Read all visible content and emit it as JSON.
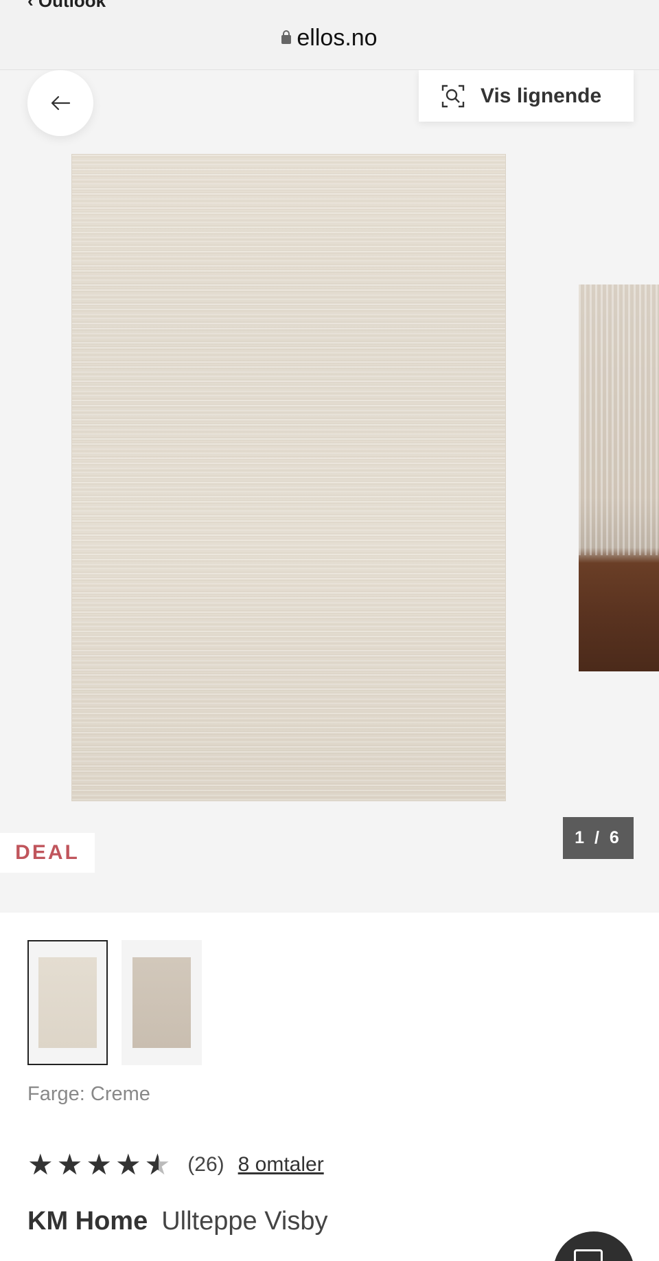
{
  "browser": {
    "back_app_label": "‹ Outlook",
    "url": "ellos.no"
  },
  "gallery": {
    "back_icon": "arrow-left-icon",
    "similar_label": "Vis lignende",
    "similar_icon": "visual-search-icon",
    "deal_label": "DEAL",
    "counter": "1 / 6",
    "deal_color": "#c0555c"
  },
  "thumbnails": [
    {
      "selected": true
    },
    {
      "selected": false
    }
  ],
  "product": {
    "color_line": "Farge: Creme",
    "rating_value": 4.5,
    "rating_count": "(26)",
    "reviews_link": "8 omtaler",
    "brand": "KM Home",
    "name": "Ullteppe Visby"
  },
  "chat": {
    "icon": "chat-icon"
  }
}
